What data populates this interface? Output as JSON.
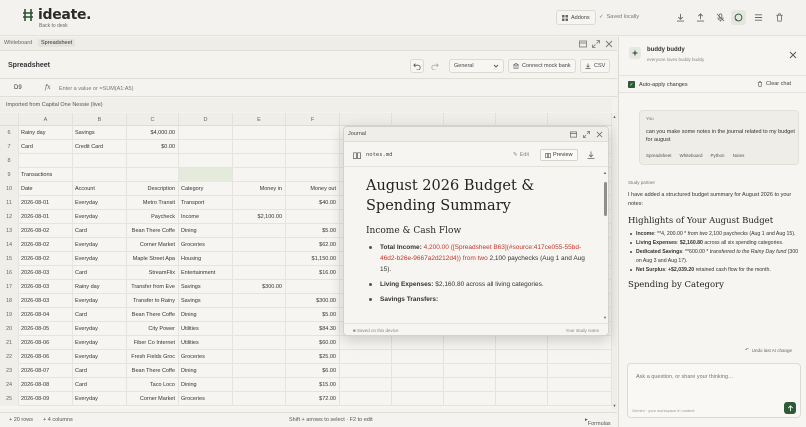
{
  "header": {
    "logo_text": "ideate.",
    "back_link": "Back to desk",
    "addons_label": "Addons",
    "saved_status": "Saved locally"
  },
  "workspace_tabs": [
    "Whiteboard",
    "Spreadsheet"
  ],
  "sheet": {
    "title": "Spreadsheet",
    "format_value": "General",
    "connect_label": "Connect mock bank",
    "csv_label": "CSV",
    "cell_ref": "D9",
    "fx": "fx",
    "formula_placeholder": "Enter a value or =SUM(A1:A5)",
    "import_banner": "Imported from Capital One Nessie (live)",
    "columns": [
      "A",
      "B",
      "C",
      "D",
      "E",
      "F"
    ],
    "rows": [
      {
        "n": "6",
        "cells": [
          "Rainy day",
          "Savings",
          "$4,000.00",
          "",
          "",
          ""
        ]
      },
      {
        "n": "7",
        "cells": [
          "Card",
          "Credit Card",
          "$0.00",
          "",
          "",
          ""
        ]
      },
      {
        "n": "8",
        "cells": [
          "",
          "",
          "",
          "",
          "",
          ""
        ]
      },
      {
        "n": "9",
        "cells": [
          "Transactions",
          "",
          "",
          "",
          "",
          ""
        ]
      },
      {
        "n": "10",
        "cells": [
          "Date",
          "Account",
          "Description",
          "Category",
          "Money in",
          "Money out"
        ]
      },
      {
        "n": "11",
        "cells": [
          "2026-08-01",
          "Everyday",
          "Metro Transit",
          "Transport",
          "",
          "$40.00"
        ]
      },
      {
        "n": "12",
        "cells": [
          "2026-08-01",
          "Everyday",
          "Paycheck",
          "Income",
          "$2,100.00",
          ""
        ]
      },
      {
        "n": "13",
        "cells": [
          "2026-08-02",
          "Card",
          "Bean There Coffe",
          "Dining",
          "",
          "$5.00"
        ]
      },
      {
        "n": "14",
        "cells": [
          "2026-08-02",
          "Everyday",
          "Corner Market",
          "Groceries",
          "",
          "$62.00"
        ]
      },
      {
        "n": "15",
        "cells": [
          "2026-08-02",
          "Everyday",
          "Maple Street Apa",
          "Housing",
          "",
          "$1,150.00"
        ]
      },
      {
        "n": "16",
        "cells": [
          "2026-08-03",
          "Card",
          "StreamFlix",
          "Entertainment",
          "",
          "$16.00"
        ]
      },
      {
        "n": "17",
        "cells": [
          "2026-08-03",
          "Rainy day",
          "Transfer from Eve",
          "Savings",
          "$300.00",
          ""
        ]
      },
      {
        "n": "18",
        "cells": [
          "2026-08-03",
          "Everyday",
          "Transfer to Rainy",
          "Savings",
          "",
          "$300.00"
        ]
      },
      {
        "n": "19",
        "cells": [
          "2026-08-04",
          "Card",
          "Bean There Coffe",
          "Dining",
          "",
          "$5.00"
        ]
      },
      {
        "n": "20",
        "cells": [
          "2026-08-05",
          "Everyday",
          "City Power",
          "Utilities",
          "",
          "$84.30"
        ]
      },
      {
        "n": "21",
        "cells": [
          "2026-08-06",
          "Everyday",
          "Fiber Co Internet",
          "Utilities",
          "",
          "$60.00"
        ]
      },
      {
        "n": "22",
        "cells": [
          "2026-08-06",
          "Everyday",
          "Fresh Fields Groc",
          "Groceries",
          "",
          "$25.00"
        ]
      },
      {
        "n": "23",
        "cells": [
          "2026-08-07",
          "Card",
          "Bean There Coffe",
          "Dining",
          "",
          "$6.00"
        ]
      },
      {
        "n": "24",
        "cells": [
          "2026-08-08",
          "Card",
          "Taco Loco",
          "Dining",
          "",
          "$15.00"
        ]
      },
      {
        "n": "25",
        "cells": [
          "2026-08-09",
          "Everyday",
          "Corner Market",
          "Groceries",
          "",
          "$72.00"
        ]
      }
    ],
    "status_rows": "+ 20 rows",
    "status_cols": "+ 4 columns",
    "status_hint": "Shift + arrows to select · F2 to edit",
    "status_formulas": "Formulas"
  },
  "journal": {
    "title": "Journal",
    "file_name": "notes.md",
    "edit_label": "Edit",
    "preview_label": "Preview",
    "h1": "August 2026 Budget & Spending Summary",
    "h2": "Income & Cash Flow",
    "item1_label": "Total Income:",
    "item1_red": "4,200.00 ([Spreadsheet B63](#source:417ce055-55bd-46d2-b26e-9667a2d212d4)) from two",
    "item1_rest": "2,100 paychecks (Aug 1 and Aug 15).",
    "item2_label": "Living Expenses:",
    "item2_rest": "$2,160.80 across all living categories.",
    "item3_label": "Savings Transfers:",
    "footer_saved": "Saved on this device",
    "footer_notes": "Your study notes"
  },
  "chat": {
    "bot_name": "buddy buddy",
    "bot_tagline": "everyone loves buddy buddy",
    "auto_apply": "Auto-apply changes",
    "clear_chat": "Clear chat",
    "user_label": "You",
    "user_message": "can you make some notes in the journal related to my budget for august",
    "context_chips": [
      "Spreadsheet",
      "Whiteboard",
      "Python",
      "Notes"
    ],
    "partner_label": "Study partner",
    "intro": "I have added a structured budget summary for August 2026 to your notes:",
    "h1": "Highlights of Your August Budget",
    "bullets": [
      {
        "b": "Income",
        "t": ": **4, 200.00 *  ",
        "i": "from two",
        "t2": " 2,100 paychecks (Aug 1 and Aug 15)."
      },
      {
        "b": "Living Expenses",
        "t": ": ",
        "b2": "$2,160.80",
        "t2": " across all six spending categories."
      },
      {
        "b": "Dedicated Savings",
        "t": ": **600.00 * ",
        "i": "transferred to the Rainy Day fund",
        "t2": " (300 on Aug 3 and Aug 17)."
      },
      {
        "b": "Net Surplus",
        "t": ": ",
        "b2": "+$2,039.20",
        "t2": " retained cash flow for the month."
      }
    ],
    "h2": "Spending by Category",
    "undo": "Undo last AI change",
    "input_placeholder": "Ask a question, or share your thinking…",
    "input_hint": "Gemini · your workspace in context"
  }
}
